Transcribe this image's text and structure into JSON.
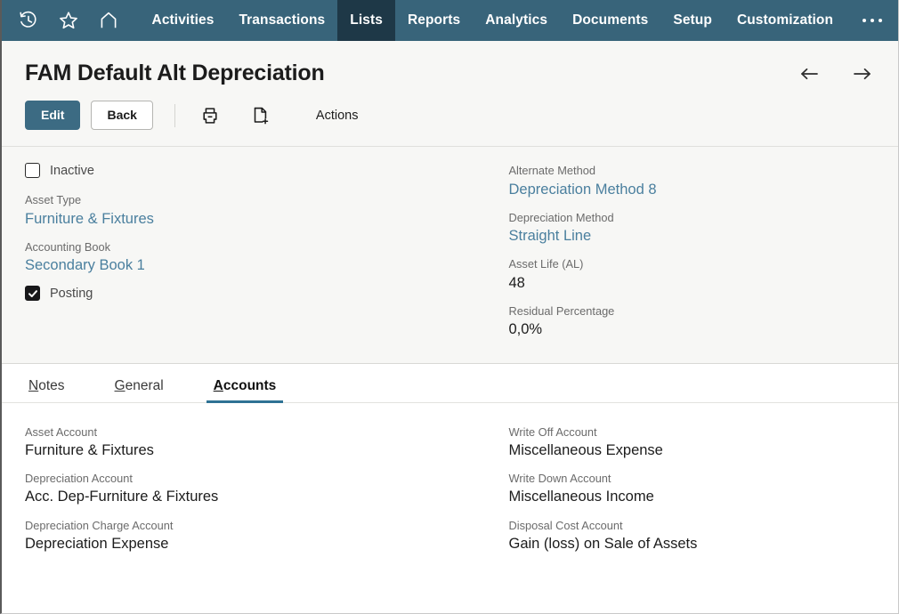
{
  "navbar": {
    "icons": [
      {
        "name": "recent-history-icon",
        "label": "Recent Records"
      },
      {
        "name": "favorites-star-icon",
        "label": "Shortcuts"
      },
      {
        "name": "home-icon",
        "label": "Home"
      }
    ],
    "items": [
      {
        "label": "Activities",
        "active": false
      },
      {
        "label": "Transactions",
        "active": false
      },
      {
        "label": "Lists",
        "active": true
      },
      {
        "label": "Reports",
        "active": false
      },
      {
        "label": "Analytics",
        "active": false
      },
      {
        "label": "Documents",
        "active": false
      },
      {
        "label": "Setup",
        "active": false
      },
      {
        "label": "Customization",
        "active": false
      }
    ],
    "overflow_label": "More",
    "bg_color": "#38647a",
    "active_bg_color": "#1e3847"
  },
  "header": {
    "title": "FAM Default Alt Depreciation",
    "prev_label": "Previous",
    "next_label": "Next"
  },
  "toolbar": {
    "edit_label": "Edit",
    "back_label": "Back",
    "print_label": "Print",
    "new_label": "New",
    "actions_label": "Actions",
    "primary_color": "#3c6b83"
  },
  "summary": {
    "left": {
      "inactive_checkbox": {
        "label": "Inactive",
        "checked": false
      },
      "fields": [
        {
          "label": "Asset Type",
          "value": "Furniture & Fixtures",
          "link": true
        },
        {
          "label": "Accounting Book",
          "value": "Secondary Book 1",
          "link": true
        }
      ],
      "posting_checkbox": {
        "label": "Posting",
        "checked": true
      }
    },
    "right": {
      "fields": [
        {
          "label": "Alternate Method",
          "value": "Depreciation Method 8",
          "link": true
        },
        {
          "label": "Depreciation Method",
          "value": "Straight Line",
          "link": true
        },
        {
          "label": "Asset Life (AL)",
          "value": "48",
          "link": false
        },
        {
          "label": "Residual Percentage",
          "value": "0,0%",
          "link": false
        }
      ]
    }
  },
  "tabs": [
    {
      "accel": "N",
      "rest": "otes",
      "active": false
    },
    {
      "accel": "G",
      "rest": "eneral",
      "active": false
    },
    {
      "accel": "A",
      "rest": "ccounts",
      "active": true
    }
  ],
  "tab_body": {
    "left_fields": [
      {
        "label": "Asset Account",
        "value": "Furniture & Fixtures"
      },
      {
        "label": "Depreciation Account",
        "value": "Acc. Dep-Furniture & Fixtures"
      },
      {
        "label": "Depreciation Charge Account",
        "value": "Depreciation Expense"
      }
    ],
    "right_fields": [
      {
        "label": "Write Off Account",
        "value": "Miscellaneous Expense"
      },
      {
        "label": "Write Down Account",
        "value": "Miscellaneous Income"
      },
      {
        "label": "Disposal Cost Account",
        "value": "Gain (loss) on Sale of Assets"
      }
    ]
  }
}
